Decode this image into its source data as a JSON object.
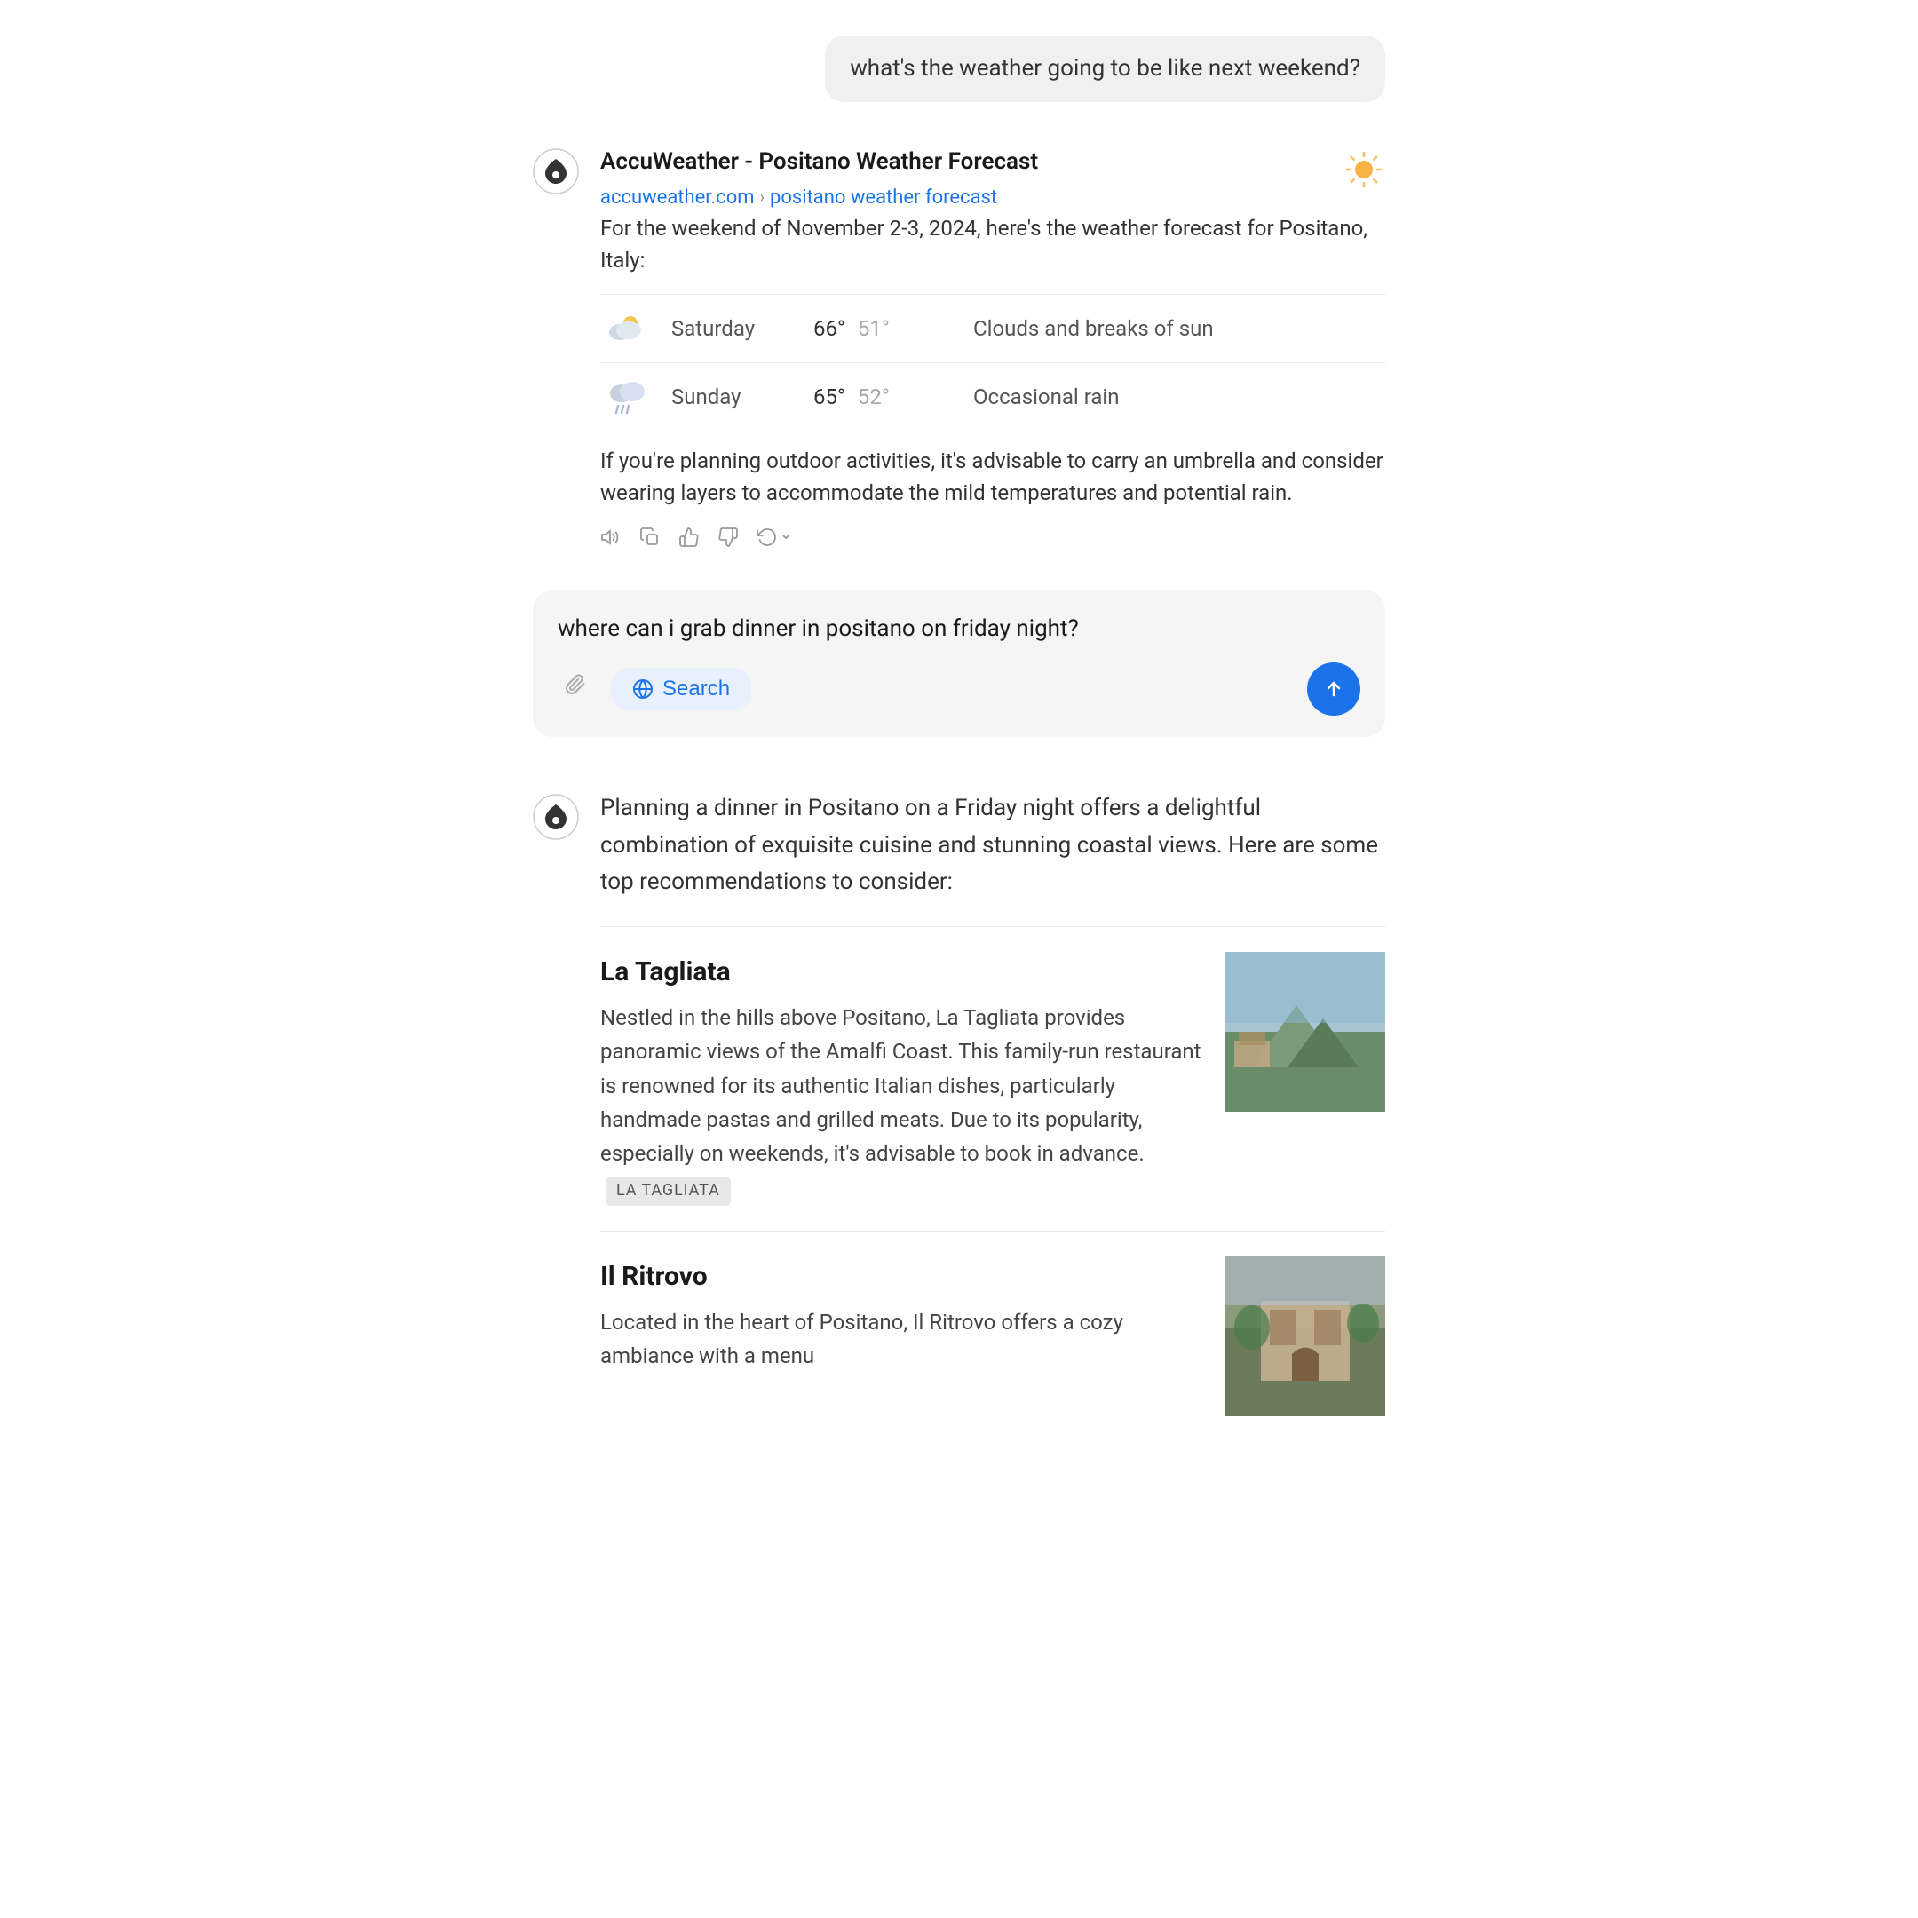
{
  "user_query_1": {
    "text": "what's the weather going to be like next weekend?"
  },
  "weather_response": {
    "source_title": "AccuWeather - Positano Weather Forecast",
    "source_domain": "accuweather.com",
    "source_path": "positano weather forecast",
    "intro": "For the weekend of November 2-3, 2024, here's the weather forecast for Positano, Italy:",
    "days": [
      {
        "icon": "partly-cloudy",
        "day": "Saturday",
        "high": "66°",
        "low": "51°",
        "description": "Clouds and breaks of sun"
      },
      {
        "icon": "rainy",
        "day": "Sunday",
        "high": "65°",
        "low": "52°",
        "description": "Occasional rain"
      }
    ],
    "advice": "If you're planning outdoor activities, it's advisable to carry an umbrella and consider wearing layers to accommodate the mild temperatures and potential rain."
  },
  "user_query_2": {
    "text": "where can i grab dinner in positano on friday night?"
  },
  "input_placeholder": "where can i grab dinner in positano on friday night?",
  "toolbar": {
    "attach_label": "📎",
    "search_label": "Search",
    "send_label": "↑"
  },
  "dinner_response": {
    "intro": "Planning a dinner in Positano on a Friday night offers a delightful combination of exquisite cuisine and stunning coastal views. Here are some top recommendations to consider:",
    "restaurants": [
      {
        "name": "La Tagliata",
        "description": "Nestled in the hills above Positano, La Tagliata provides panoramic views of the Amalfi Coast. This family-run restaurant is renowned for its authentic Italian dishes, particularly handmade pastas and grilled meats. Due to its popularity, especially on weekends, it's advisable to book in advance.",
        "tag": "LA TAGLIATA",
        "image_type": "mountain"
      },
      {
        "name": "Il Ritrovo",
        "description": "Located in the heart of Positano, Il Ritrovo offers a cozy ambiance with a menu",
        "tag": "",
        "image_type": "ritrovo"
      }
    ]
  }
}
